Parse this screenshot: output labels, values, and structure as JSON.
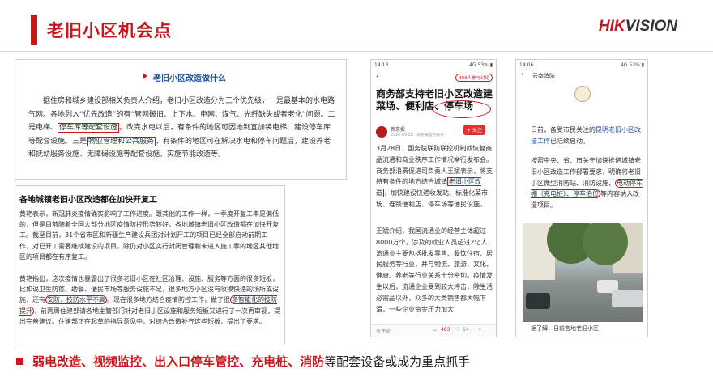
{
  "header": {
    "title": "老旧小区机会点",
    "logo_part1": "HIK",
    "logo_part2": "VISION"
  },
  "panel1": {
    "title": "老旧小区改造做什么",
    "para": [
      "据住房和城乡建设部相关负责人介绍，老旧小区改造分为三个优先级，一是最基本的水",
      "电路气网。各地列入“优先改造”的有“管网破旧、上下水、电网、煤气、光纤缺失或者老",
      "化”问题。二是电梯、",
      "停车库等配套设施",
      "。改完水电以后，有条件的地区可因地制宜加装电",
      "梯、建设停车库等配套设施。三是",
      "物业管理和公共服务",
      "，有条件的地区可在解决水电和停车",
      "问题后，建设养老和抚幼服务设施、无障碍设施等配套设施，实施节能改造等。"
    ]
  },
  "panel2": {
    "title": "各地城镇老旧小区改造都在加快开复工",
    "para1": "黄艳表示，新冠肺炎疫情确实影响了工作进度。跟其他的工作一样，一季度开复工率是偏低的，但是目前随着全国大部分地区疫情防控形势转好，各地城镇老旧小区改造都在加快开复工。截至目前，31个省市区和新疆生产建设兵团对计划开工的项目已经全部启动前期工作，对已开工需要继续建设的项目，除仍对小区实行封闭管理和未进入施工季的地区其他地区的项目都在有序复工。",
    "para2_a": "黄艳指出，这次疫情也暴露出了很多老旧小区在社区治理、设施、服务等方面的很多短板，比如说卫生防疫、助餐、便民市场等服务设施不足，很多地方小区没有收摸快递的场所或设施，还有",
    "para2_b": "安防，技防水平不高",
    "para2_c": "。现在很多地方结合疫情防控工作，做了很",
    "para2_d": "多智能化的技防提升",
    "para2_e": "，前两周住建部请各地主管部门针对老旧小区设施和服务短板又进行了一次再审视，提出完善建议。住建部正在起草的指导意见中，对结合改造补齐这些短板，提出了要求。"
  },
  "phone1": {
    "time": "14:13",
    "signal": "4G 53% ▮",
    "back": "‹",
    "badge": "403人参与讨论",
    "headline": "商务部支持老旧小区改造建菜场、便利店、停车场",
    "source": "新京报",
    "date": "2020-03-28 · 新京报官方账号",
    "follow": "+ 关注",
    "body1": "3月28日，国务院联防联控机制就恢复商品流通和商业秩序工作情况举行发布会。商务部消费促进司负责人王斌表示，将支持有条件的地方结合城镇",
    "body_hl": "老旧小区改造",
    "body2": "，加快建设快递收发站、标准化菜市场、连锁便利店、停车场等便民设施。",
    "body3": "王斌介绍，我国流通业的经营主体超过8000万个，涉及的就业人员超过2亿人，流通业主要包括批发零售、餐饮住宿、居民服务等行业，并与物流、旅游、文化、健康、养老等行业关系十分密切。疫情发生以后，流通企业受到较大冲击，除生活必需品以外，众多的大类销售都大幅下滑，一些企业资金压力加大",
    "write": "写评论",
    "comments": "403",
    "likes": "14"
  },
  "phone2": {
    "time": "14:06",
    "signal": "4G 53% ▮",
    "back": "‹",
    "account": "云南消防",
    "line1": "日前，备受市民关注的",
    "line1_hl": "昆明老旧小区改造工作",
    "line1_end": "已陆续启动。",
    "line2": "按照中央、省、市关于加快推进城镇老旧小区改造工作部署要求，明确将老旧小区微型消防站、",
    "line2_b": "消防设施",
    "line2_c": "、",
    "line2_hl1": "电动停车棚（充电桩）、停车泊位",
    "line2_d": "等内容纳入改造项目。",
    "footer": "据了解，日前各地老旧小区"
  },
  "bottom": {
    "items": [
      "弱电改造",
      "视频监控",
      "出入口停车管控",
      "充电桩",
      "消防"
    ],
    "sep": "、",
    "tail": "等配套设备或成为重点抓手"
  },
  "colors": {
    "accent": "#c8161d",
    "blue_title": "#1d4f9c"
  }
}
